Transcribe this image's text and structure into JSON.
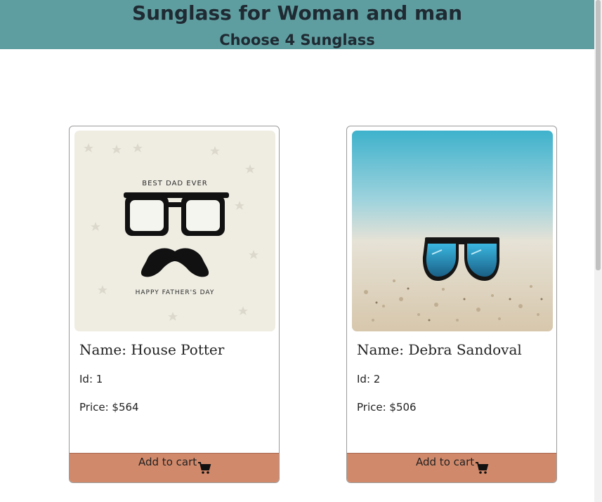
{
  "header": {
    "title": "Sunglass for Woman and man",
    "subtitle": "Choose 4 Sunglass"
  },
  "products": [
    {
      "image_caption_top": "BEST DAD EVER",
      "image_caption_bottom": "HAPPY FATHER'S DAY",
      "name": "Name: House Potter",
      "id": "Id: 1",
      "price": "Price: $564",
      "cart_label": "Add to cart",
      "cart_icon": "shopping-cart-icon"
    },
    {
      "name": "Name: Debra Sandoval",
      "id": "Id: 2",
      "price": "Price: $506",
      "cart_label": "Add to cart",
      "cart_icon": "shopping-cart-icon"
    }
  ],
  "colors": {
    "header_bg": "#5f9ea0",
    "cart_button_bg": "#d1896b"
  }
}
